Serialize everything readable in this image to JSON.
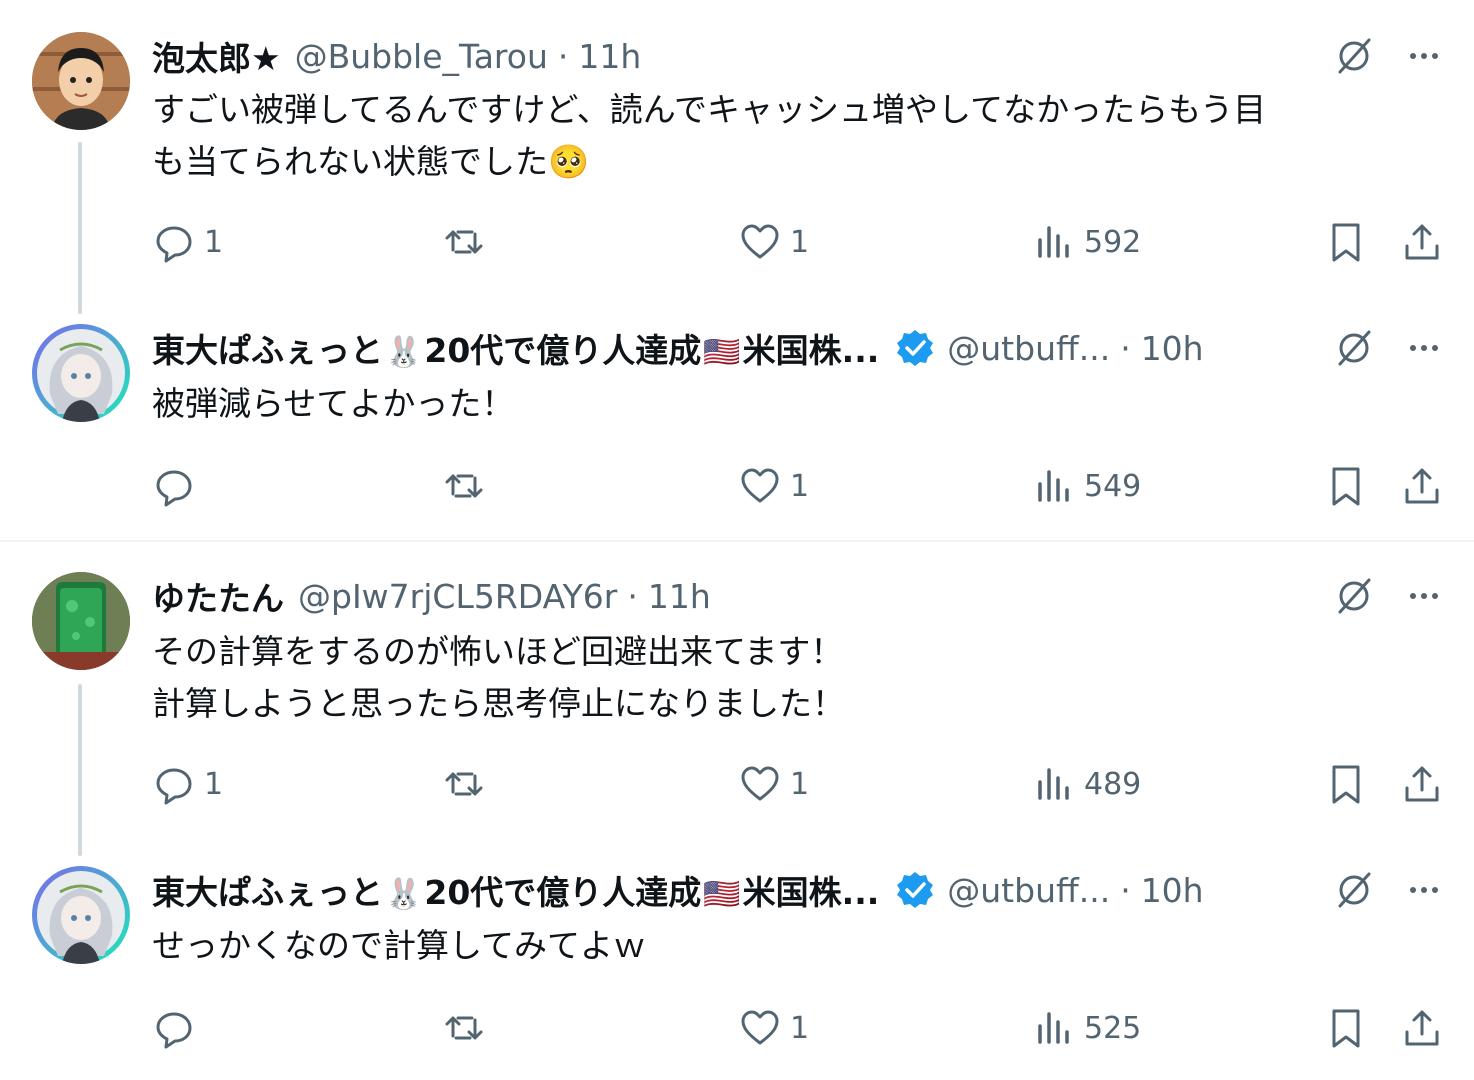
{
  "threads": [
    {
      "tweets": [
        {
          "name": "泡太郎★",
          "handle": "@Bubble_Tarou",
          "time": "11h",
          "text": "すごい被弾してるんですけど、読んでキャッシュ増やしてなかったらもう目\nも当てられない状態でした🥺",
          "replies": "1",
          "reposts": "",
          "likes": "1",
          "views": "592"
        },
        {
          "name_part1": "東大ぱふぇっと",
          "emoji1": "🐰",
          "name_part2": "20代で億り人達成",
          "emoji2": "🇺🇸",
          "name_part3": "米国株...",
          "handle": "@utbuff...",
          "time": "10h",
          "text": "被弾減らせてよかった！",
          "replies": "",
          "reposts": "",
          "likes": "1",
          "views": "549"
        }
      ]
    },
    {
      "tweets": [
        {
          "name": "ゆたたん",
          "handle": "@pIw7rjCL5RDAY6r",
          "time": "11h",
          "text": "その計算をするのが怖いほど回避出来てます！\n計算しようと思ったら思考停止になりました！",
          "replies": "1",
          "reposts": "",
          "likes": "1",
          "views": "489"
        },
        {
          "name_part1": "東大ぱふぇっと",
          "emoji1": "🐰",
          "name_part2": "20代で億り人達成",
          "emoji2": "🇺🇸",
          "name_part3": "米国株...",
          "handle": "@utbuff...",
          "time": "10h",
          "text": "せっかくなので計算してみてよｗ",
          "replies": "",
          "reposts": "",
          "likes": "1",
          "views": "525"
        }
      ]
    }
  ],
  "separator": "·",
  "colors": {
    "text": "#0f1419",
    "secondary": "#536471",
    "verified": "#1d9bf0",
    "thread_line": "#cfd9de",
    "divider": "#eff3f4"
  },
  "icons": [
    "reply-icon",
    "repost-icon",
    "like-icon",
    "views-icon",
    "bookmark-icon",
    "share-icon",
    "grok-icon",
    "more-icon",
    "verified-badge-icon"
  ]
}
